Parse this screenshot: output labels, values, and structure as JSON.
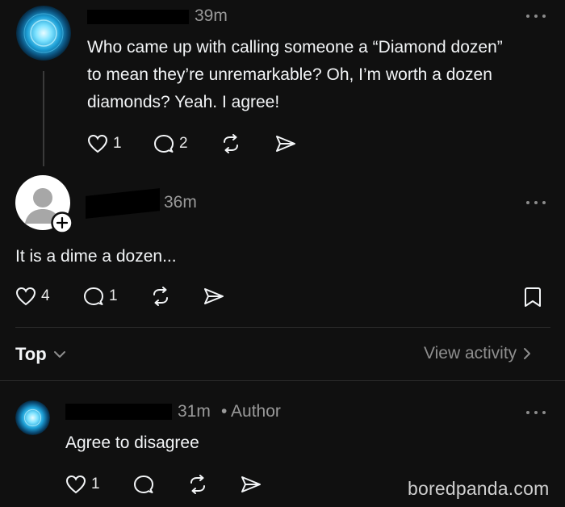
{
  "post": {
    "timestamp": "39m",
    "text_line1": "Who came up with calling someone a “Diamond dozen”",
    "text_line2": "to mean they’re unremarkable? Oh, I’m worth a dozen",
    "text_line3": "diamonds? Yeah. I agree!",
    "likes": "1",
    "replies": "2"
  },
  "reply1": {
    "timestamp": "36m",
    "text": "It is a dime a dozen...",
    "likes": "4",
    "replies": "1"
  },
  "sort": {
    "label": "Top",
    "view_activity": "View activity"
  },
  "reply2": {
    "timestamp": "31m",
    "author_tag": "• Author",
    "text": "Agree to disagree",
    "likes": "1"
  },
  "watermark": "boredpanda.com",
  "colors": {
    "background": "#101010",
    "text": "#f3f5f7",
    "muted": "#9a9a9a",
    "orb": "#3cc4f0"
  }
}
